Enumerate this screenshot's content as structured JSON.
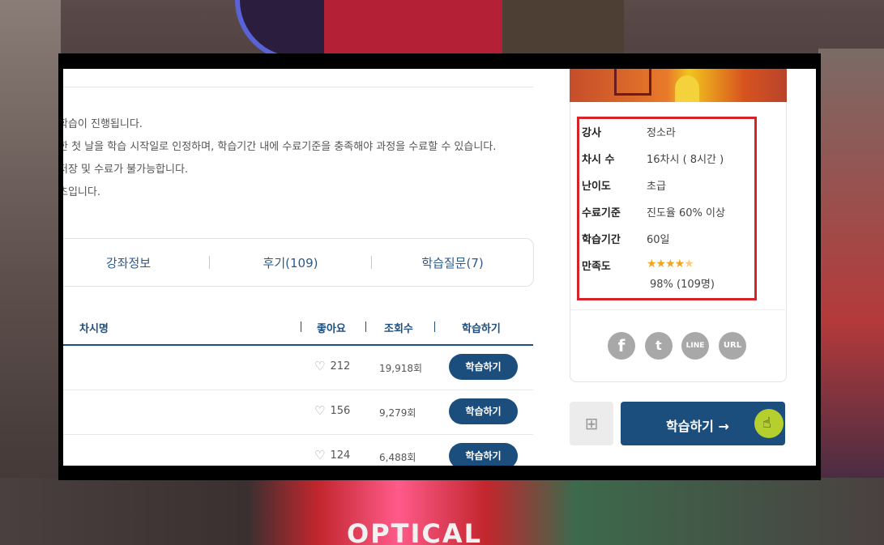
{
  "notice": {
    "lines": [
      "학습이 진행됩니다.",
      "한 첫 날을 학습 시작일로 인정하며, 학습기간 내에 수료기준을 충족해야 과정을 수료할 수 있습니다.",
      " 저장 및 수료가 불가능합니다.",
      "츠입니다."
    ]
  },
  "tabs": [
    "강좌정보",
    "후기(109)",
    "학습질문(7)"
  ],
  "table": {
    "headers": {
      "name": "차시명",
      "likes": "좋아요",
      "views": "조회수",
      "action": "학습하기"
    },
    "rows": [
      {
        "likes": "212",
        "views": "19,918회",
        "button": "학습하기"
      },
      {
        "likes": "156",
        "views": "9,279회",
        "button": "학습하기"
      },
      {
        "likes": "124",
        "views": "6,488회",
        "button": "학습하기"
      }
    ]
  },
  "course_info": {
    "instructor_label": "강사",
    "instructor": "정소라",
    "sessions_label": "차시 수",
    "sessions": "16차시 ( 8시간 )",
    "level_label": "난이도",
    "level": "초급",
    "criteria_label": "수료기준",
    "criteria": "진도율 60% 이상",
    "period_label": "학습기간",
    "period": "60일",
    "satisfaction_label": "만족도",
    "rating": 4.5,
    "satisfaction": "98% (109명)"
  },
  "social": {
    "facebook": "f",
    "twitter": "t",
    "line": "LINE",
    "url": "URL"
  },
  "cta": {
    "label": "학습하기 →"
  },
  "background": {
    "sign_text": "OPTICAL"
  },
  "colors": {
    "primary": "#1c4e7d",
    "highlight_border": "#d8222a",
    "star": "#f0a51d"
  }
}
